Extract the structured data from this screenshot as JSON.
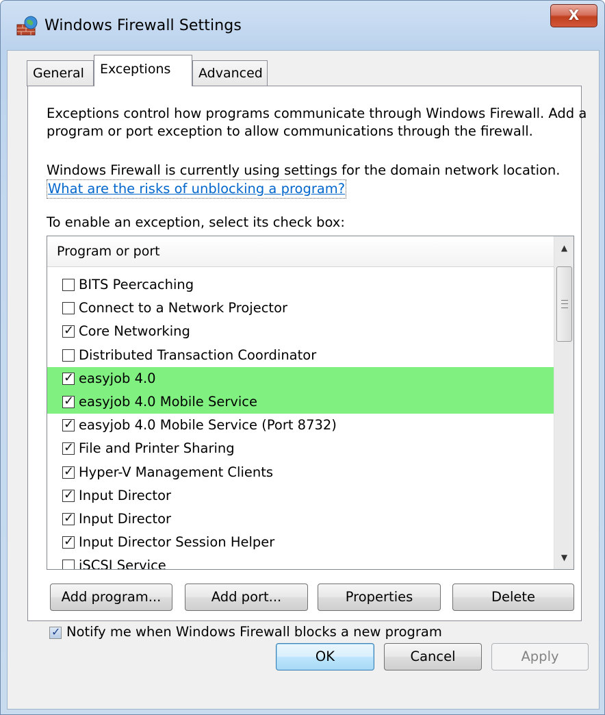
{
  "window": {
    "title": "Windows Firewall Settings",
    "close_glyph": "X",
    "app_icon": "firewall-icon"
  },
  "tabs": [
    {
      "label": "General",
      "active": false
    },
    {
      "label": "Exceptions",
      "active": true
    },
    {
      "label": "Advanced",
      "active": false
    }
  ],
  "exceptions": {
    "description": "Exceptions control how programs communicate through Windows Firewall. Add a program or port exception to allow communications through the firewall.",
    "domain_text": "Windows Firewall is currently using settings for the domain network location.",
    "risk_link": "What are the risks of unblocking a program?",
    "select_label": "To enable an exception, select its check box:",
    "list_header": "Program or port",
    "highlight_color": "#80f080",
    "items": [
      {
        "label": "BITS Peercaching",
        "checked": false,
        "highlighted": false
      },
      {
        "label": "Connect to a Network Projector",
        "checked": false,
        "highlighted": false
      },
      {
        "label": "Core Networking",
        "checked": true,
        "highlighted": false
      },
      {
        "label": "Distributed Transaction Coordinator",
        "checked": false,
        "highlighted": false
      },
      {
        "label": "easyjob 4.0",
        "checked": true,
        "highlighted": true
      },
      {
        "label": "easyjob 4.0 Mobile Service",
        "checked": true,
        "highlighted": true
      },
      {
        "label": "easyjob 4.0 Mobile Service (Port 8732)",
        "checked": true,
        "highlighted": false
      },
      {
        "label": "File and Printer Sharing",
        "checked": true,
        "highlighted": false
      },
      {
        "label": "Hyper-V Management Clients",
        "checked": true,
        "highlighted": false
      },
      {
        "label": "Input Director",
        "checked": true,
        "highlighted": false
      },
      {
        "label": "Input Director",
        "checked": true,
        "highlighted": false
      },
      {
        "label": "Input Director Session Helper",
        "checked": true,
        "highlighted": false
      },
      {
        "label": "iSCSI Service",
        "checked": false,
        "highlighted": false
      }
    ],
    "buttons": {
      "add_program": "Add program...",
      "add_port": "Add port...",
      "properties": "Properties",
      "delete": "Delete"
    },
    "notify": {
      "label": "Notify me when Windows Firewall blocks a new program",
      "checked": true
    }
  },
  "footer": {
    "ok": "OK",
    "cancel": "Cancel",
    "apply": "Apply"
  }
}
